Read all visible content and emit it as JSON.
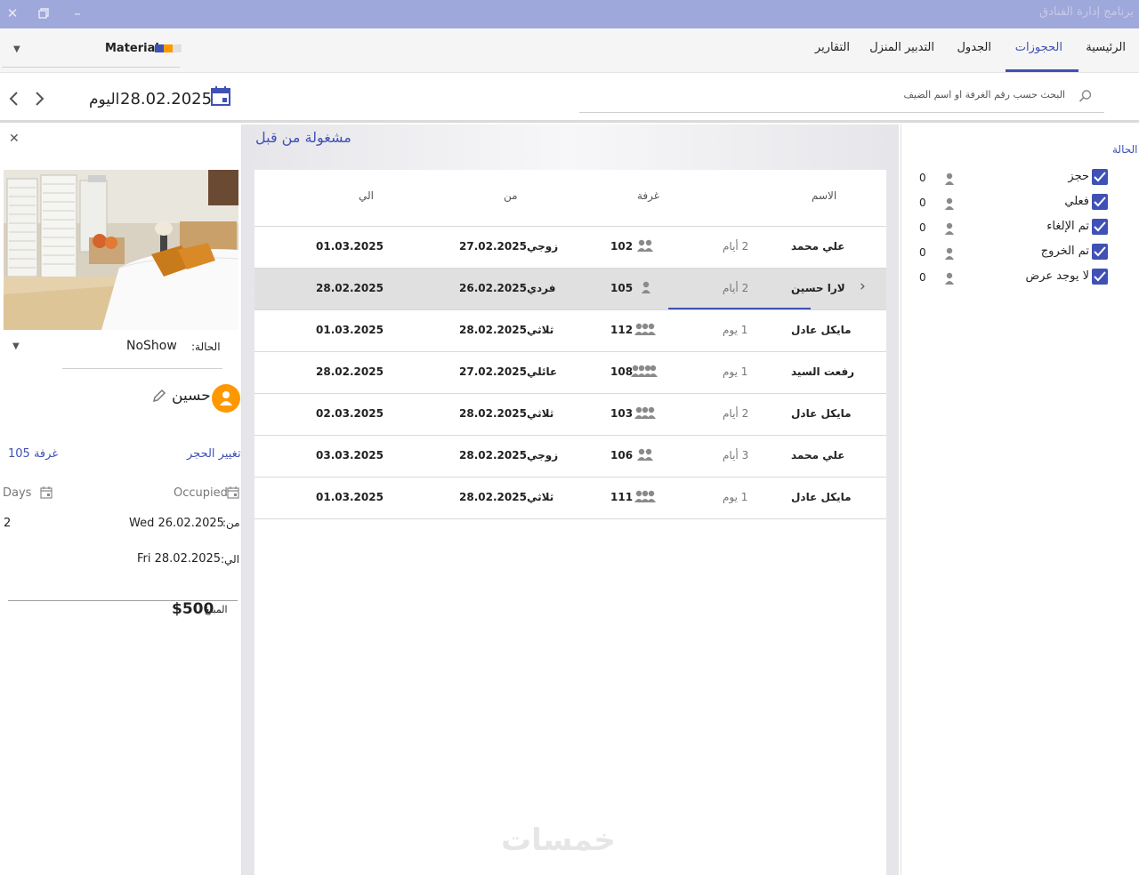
{
  "titlebar": {
    "title": "برنامج إدارة الفنادق"
  },
  "menu": {
    "items": [
      {
        "label": "الرئيسية"
      },
      {
        "label": "الحجوزات"
      },
      {
        "label": "الجدول"
      },
      {
        "label": "التدبير المنزل"
      },
      {
        "label": "التقارير"
      }
    ],
    "active_index": 1
  },
  "theme": {
    "label": "Material",
    "colors": [
      "#3f51b5",
      "#ff9800",
      "#e0e0e0"
    ]
  },
  "search": {
    "placeholder": "البحث حسب رقم الغرفة او اسم الضيف"
  },
  "date": {
    "value": "28.02.2025",
    "today_label": "اليوم"
  },
  "section_title": "مشغولة من قبل",
  "table": {
    "headers": {
      "name": "الاسم",
      "room": "غرفة",
      "from": "من",
      "to": "الي"
    },
    "rows": [
      {
        "name": "علي محمد",
        "days": "2 أيام",
        "room": "102",
        "guests": 2,
        "type": "زوجي",
        "from": "27.02.2025",
        "to": "01.03.2025"
      },
      {
        "name": "لارا حسين",
        "days": "2 أيام",
        "room": "105",
        "guests": 1,
        "type": "فردي",
        "from": "26.02.2025",
        "to": "28.02.2025",
        "selected": true
      },
      {
        "name": "مايكل عادل",
        "days": "1 يوم",
        "room": "112",
        "guests": 3,
        "type": "ثلاثي",
        "from": "28.02.2025",
        "to": "01.03.2025"
      },
      {
        "name": "رفعت السيد",
        "days": "1 يوم",
        "room": "108",
        "guests": 4,
        "type": "عائلي",
        "from": "27.02.2025",
        "to": "28.02.2025"
      },
      {
        "name": "مايكل عادل",
        "days": "2 أيام",
        "room": "103",
        "guests": 3,
        "type": "ثلاثي",
        "from": "28.02.2025",
        "to": "02.03.2025"
      },
      {
        "name": "علي محمد",
        "days": "3 أيام",
        "room": "106",
        "guests": 2,
        "type": "زوجي",
        "from": "28.02.2025",
        "to": "03.03.2025"
      },
      {
        "name": "مايكل عادل",
        "days": "1 يوم",
        "room": "111",
        "guests": 3,
        "type": "ثلاثي",
        "from": "28.02.2025",
        "to": "01.03.2025"
      }
    ]
  },
  "details": {
    "status_label": "الحالة:",
    "status_value": "NoShow",
    "guest_name": "حسين",
    "change_booking": "تغيير الحجر",
    "room_label": "غرفة 105",
    "occupied_label": "Occupied",
    "days_label": "Days",
    "from_label": "من:",
    "from_value": "Wed 26.02.2025",
    "days_value": "2",
    "to_label": "الي:",
    "to_value": "Fri 28.02.2025",
    "amount_label": "المبلغ",
    "amount_value": "$500"
  },
  "filters": {
    "title": "الحالة",
    "items": [
      {
        "label": "حجز",
        "count": "0"
      },
      {
        "label": "فعلي",
        "count": "0"
      },
      {
        "label": "تم الإلغاء",
        "count": "0"
      },
      {
        "label": "تم الخروج",
        "count": "0"
      },
      {
        "label": "لا يوجد عرض",
        "count": "0"
      }
    ]
  },
  "watermark": "خمسات"
}
